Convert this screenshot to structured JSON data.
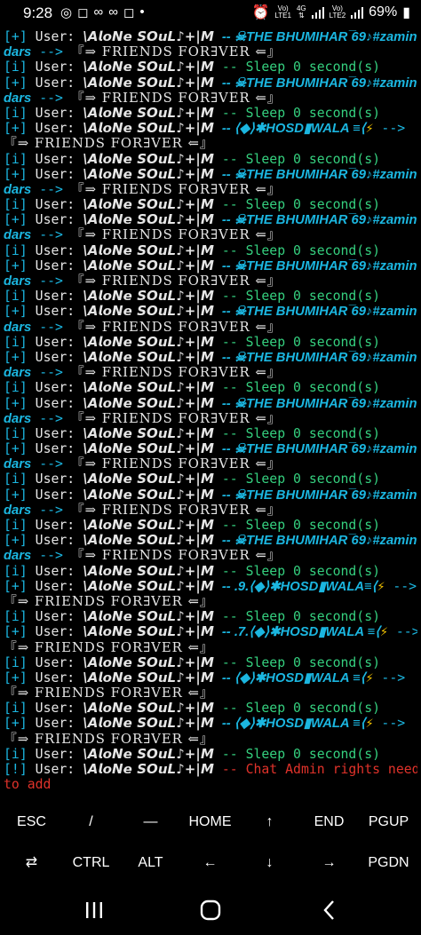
{
  "status_bar": {
    "time": "9:28",
    "left_icons": [
      "whatsapp-icon",
      "instagram-icon",
      "infinity-icon",
      "infinity-icon",
      "instagram-icon",
      "dot-icon"
    ],
    "sim1": {
      "top": "Vo)",
      "bottom": "LTE1"
    },
    "net": {
      "top": "4G",
      "bottom": ""
    },
    "sim2": {
      "top": "Vo)",
      "bottom": "LTE2"
    },
    "battery": "69%"
  },
  "terminal": {
    "user_label": "User:",
    "user_name": "\\𝘼𝙡𝙤𝙉𝙚 𝙎𝙊𝙪𝙇♪+|𝙈",
    "sleep_text": "-- Sleep 0 second(s)",
    "target_name": "-- ☠THE BHUMIHAR ̅69♪#zamin",
    "target_cont": "dars",
    "arrow": "-->",
    "friends": "『⇒ FRIENDS FOR∃VER ⇐』",
    "hosd": "-- ⟨◆⟩✱HOSD▮WALA ≡⟨",
    "hosd_9": "-- .9.⟨◆⟩✱HOSD▮WALA≡⟨",
    "hosd_7": "-- .7.⟨◆⟩✱HOSD▮WALA ≡⟨",
    "bolt": "⚡",
    "error_text": "-- Chat Admin rights needed",
    "error_cont": "to add",
    "tags": {
      "info": "[i]",
      "plus": "[+]",
      "bang": "[!]"
    }
  },
  "keys": {
    "row1": [
      "ESC",
      "/",
      "—",
      "HOME",
      "↑",
      "END",
      "PGUP"
    ],
    "row2": [
      "⇄",
      "CTRL",
      "ALT",
      "←",
      "↓",
      "→",
      "PGDN"
    ]
  },
  "nav": {
    "recent": "recent-apps-icon",
    "home": "home-icon",
    "back": "back-icon"
  }
}
